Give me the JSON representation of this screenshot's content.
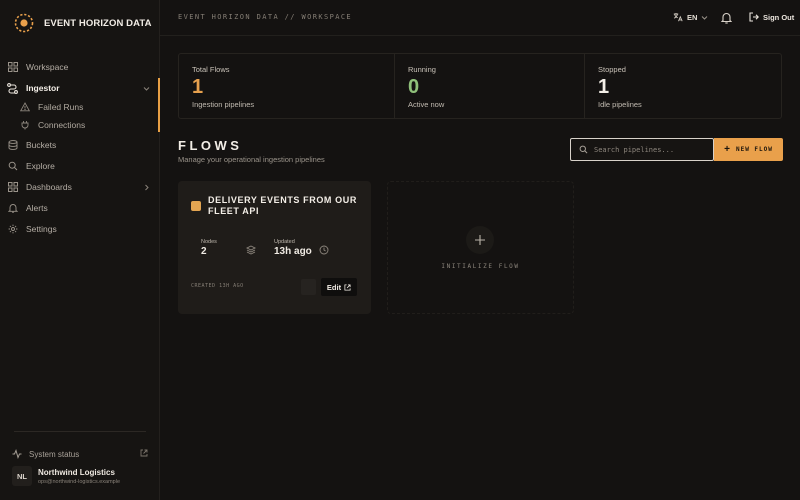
{
  "app": {
    "name": "EVENT HORIZON DATA"
  },
  "colors": {
    "accent": "#e9a04b",
    "orange_value": "#e6a04e",
    "green_value": "#8fc07a",
    "white_value": "#f3eee7"
  },
  "sidebar": {
    "items": [
      {
        "label": "Workspace",
        "icon": "grid-icon"
      },
      {
        "label": "Ingestor",
        "icon": "route-icon",
        "active": true
      },
      {
        "label": "Buckets",
        "icon": "database-icon"
      },
      {
        "label": "Explore",
        "icon": "search-icon"
      },
      {
        "label": "Dashboards",
        "icon": "dashboard-icon"
      },
      {
        "label": "Alerts",
        "icon": "bell-icon"
      },
      {
        "label": "Settings",
        "icon": "gear-icon"
      }
    ],
    "subitems": [
      {
        "label": "Failed Runs",
        "icon": "warning-icon"
      },
      {
        "label": "Connections",
        "icon": "plug-icon"
      }
    ],
    "system_status": "System status",
    "user": {
      "initials": "NL",
      "org": "Northwind Logistics",
      "email": "ops@northwind-logistics.example"
    }
  },
  "topbar": {
    "breadcrumb": "EVENT HORIZON DATA // WORKSPACE",
    "language": "EN",
    "sign_out": "Sign Out"
  },
  "stats": [
    {
      "label": "Total Flows",
      "value": "1",
      "sub": "Ingestion pipelines",
      "color": "#e6a04e"
    },
    {
      "label": "Running",
      "value": "0",
      "sub": "Active now",
      "color": "#8fc07a"
    },
    {
      "label": "Stopped",
      "value": "1",
      "sub": "Idle pipelines",
      "color": "#f3eee7"
    }
  ],
  "flows": {
    "title": "FLOWS",
    "subtitle": "Manage your operational ingestion pipelines",
    "search_placeholder": "Search pipelines...",
    "new_flow": "NEW FLOW",
    "cards": [
      {
        "title": "DELIVERY EVENTS FROM OUR FLEET API",
        "nodes_label": "Nodes",
        "nodes_value": "2",
        "updated_label": "Updated",
        "updated_value": "13h ago",
        "created": "CREATED 13H AGO",
        "edit": "Edit"
      }
    ],
    "initialize": "INITIALIZE FLOW"
  }
}
